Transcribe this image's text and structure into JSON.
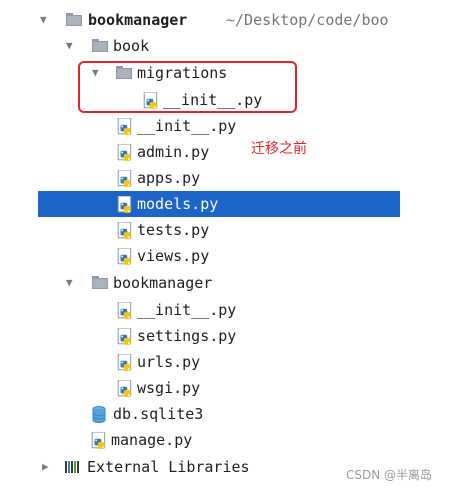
{
  "tree": {
    "root": {
      "label": "bookmanager",
      "path": "~/Desktop/code/boo"
    },
    "book": {
      "label": "book"
    },
    "migrations": {
      "label": "migrations"
    },
    "migrations_init": {
      "label": "__init__.py"
    },
    "book_init": {
      "label": "__init__.py"
    },
    "admin": {
      "label": "admin.py"
    },
    "apps": {
      "label": "apps.py"
    },
    "models": {
      "label": "models.py"
    },
    "tests": {
      "label": "tests.py"
    },
    "views": {
      "label": "views.py"
    },
    "bookmanager_pkg": {
      "label": "bookmanager"
    },
    "pkg_init": {
      "label": "__init__.py"
    },
    "settings": {
      "label": "settings.py"
    },
    "urls": {
      "label": "urls.py"
    },
    "wsgi": {
      "label": "wsgi.py"
    },
    "db": {
      "label": "db.sqlite3"
    },
    "manage": {
      "label": "manage.py"
    },
    "external": {
      "label": "External Libraries"
    }
  },
  "annotation": {
    "text": "迁移之前"
  },
  "watermark": {
    "text": "CSDN @半离岛"
  },
  "colors": {
    "selection": "#1b64c8",
    "annotation": "#e0262a"
  },
  "icons": {
    "arrow_expanded": "▼",
    "arrow_collapsed": "▶",
    "folder": "folder-icon",
    "python_file": "python-file-icon",
    "database": "database-icon",
    "libraries": "libraries-icon"
  }
}
